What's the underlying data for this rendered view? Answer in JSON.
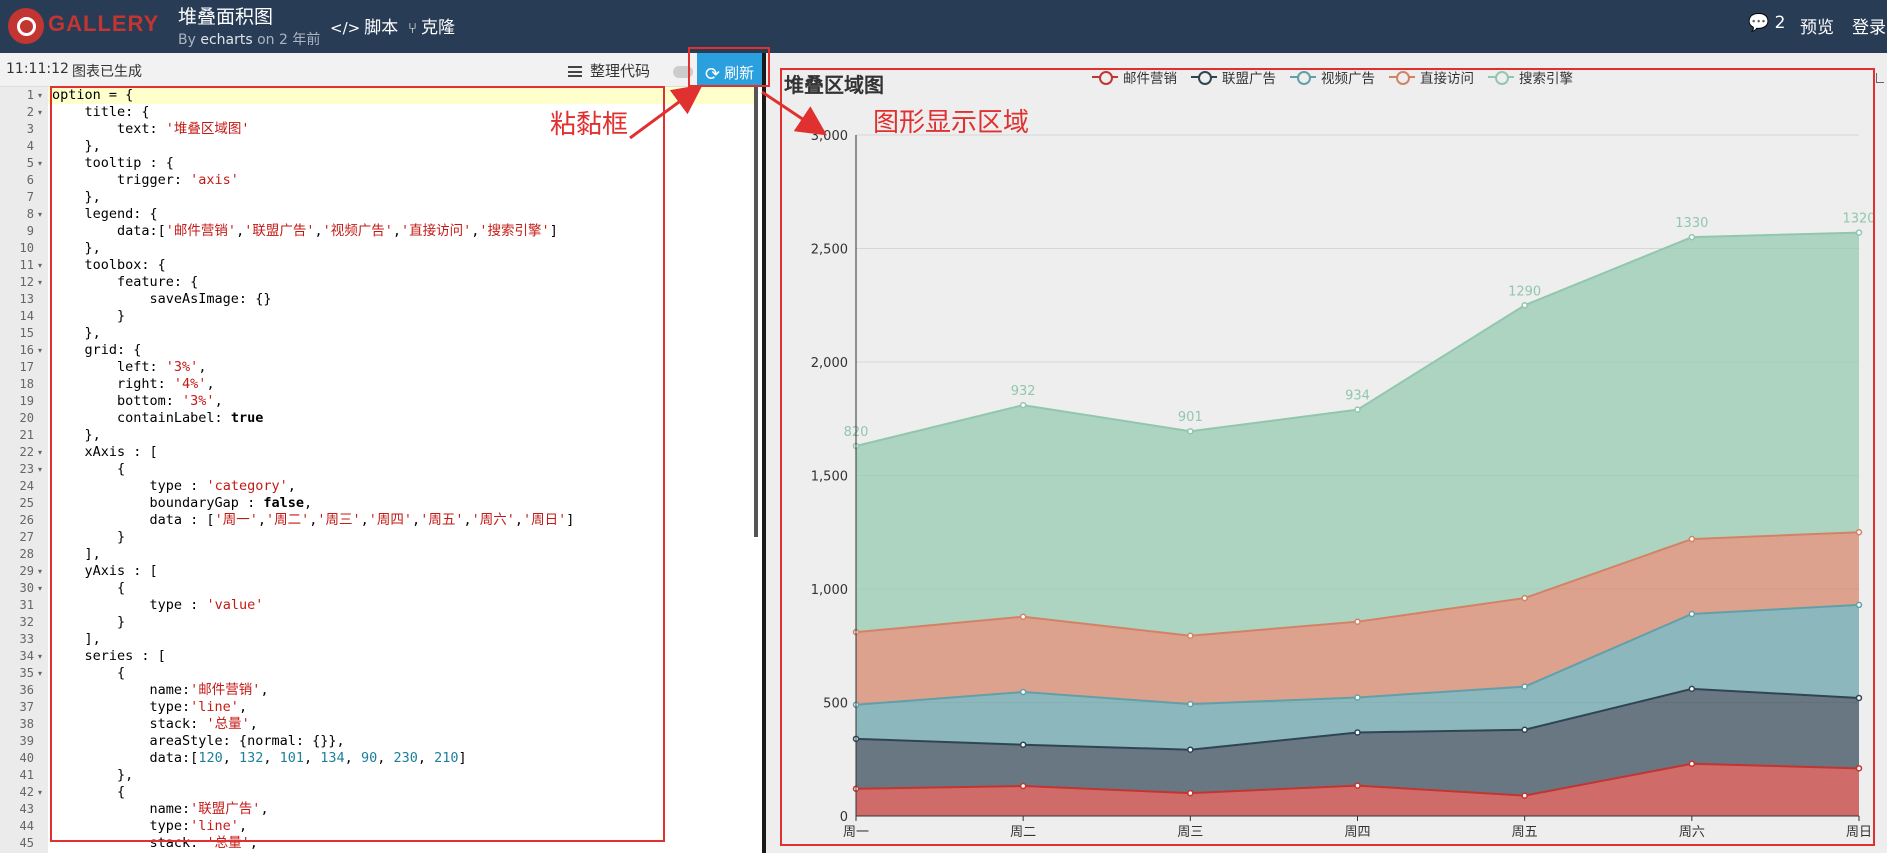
{
  "header": {
    "logo_text": "GALLERY",
    "title": "堆叠面积图",
    "by": "By",
    "author": "echarts",
    "time_ago": "on 2 年前",
    "script_label": "脚本",
    "clone_label": "克隆",
    "comment_count": "2",
    "preview_label": "预览",
    "login_label": "登录"
  },
  "toolbar": {
    "time": "11:11:12",
    "status": "图表已生成",
    "format_label": "整理代码",
    "refresh_label": "刷新"
  },
  "annotations": {
    "paste_box": "粘黏框",
    "chart_area": "图形显示区域"
  },
  "code": {
    "lines": [
      "option = {",
      "    title: {",
      "        text: '堆叠区域图'",
      "    },",
      "    tooltip : {",
      "        trigger: 'axis'",
      "    },",
      "    legend: {",
      "        data:['邮件营销','联盟广告','视频广告','直接访问','搜索引擎']",
      "    },",
      "    toolbox: {",
      "        feature: {",
      "            saveAsImage: {}",
      "        }",
      "    },",
      "    grid: {",
      "        left: '3%',",
      "        right: '4%',",
      "        bottom: '3%',",
      "        containLabel: true",
      "    },",
      "    xAxis : [",
      "        {",
      "            type : 'category',",
      "            boundaryGap : false,",
      "            data : ['周一','周二','周三','周四','周五','周六','周日']",
      "        }",
      "    ],",
      "    yAxis : [",
      "        {",
      "            type : 'value'",
      "        }",
      "    ],",
      "    series : [",
      "        {",
      "            name:'邮件营销',",
      "            type:'line',",
      "            stack: '总量',",
      "            areaStyle: {normal: {}},",
      "            data:[120, 132, 101, 134, 90, 230, 210]",
      "        },",
      "        {",
      "            name:'联盟广告',",
      "            type:'line',",
      "            stack: '总量',"
    ],
    "fold_lines": [
      1,
      2,
      5,
      8,
      11,
      12,
      16,
      22,
      23,
      29,
      30,
      34,
      35,
      42
    ]
  },
  "chart_data": {
    "type": "area",
    "stacked": true,
    "title": "堆叠区域图",
    "categories": [
      "周一",
      "周二",
      "周三",
      "周四",
      "周五",
      "周六",
      "周日"
    ],
    "series": [
      {
        "name": "邮件营销",
        "values": [
          120,
          132,
          101,
          134,
          90,
          230,
          210
        ],
        "color": "#c23531"
      },
      {
        "name": "联盟广告",
        "values": [
          220,
          182,
          191,
          234,
          290,
          330,
          310
        ],
        "color": "#2f4554"
      },
      {
        "name": "视频广告",
        "values": [
          150,
          232,
          201,
          154,
          190,
          330,
          410
        ],
        "color": "#61a0a8"
      },
      {
        "name": "直接访问",
        "values": [
          320,
          332,
          301,
          334,
          390,
          330,
          320
        ],
        "color": "#d48265"
      },
      {
        "name": "搜索引擎",
        "values": [
          820,
          932,
          901,
          934,
          1290,
          1330,
          1320
        ],
        "color": "#91c7ae"
      }
    ],
    "top_labels": [
      "820",
      "932",
      "901",
      "934",
      "1290",
      "1330",
      "1320"
    ],
    "ylim": [
      0,
      3000
    ],
    "yticks": [
      "0",
      "500",
      "1,000",
      "1,500",
      "2,000",
      "2,500",
      "3,000"
    ],
    "grid": true,
    "legend_position": "top-center"
  }
}
